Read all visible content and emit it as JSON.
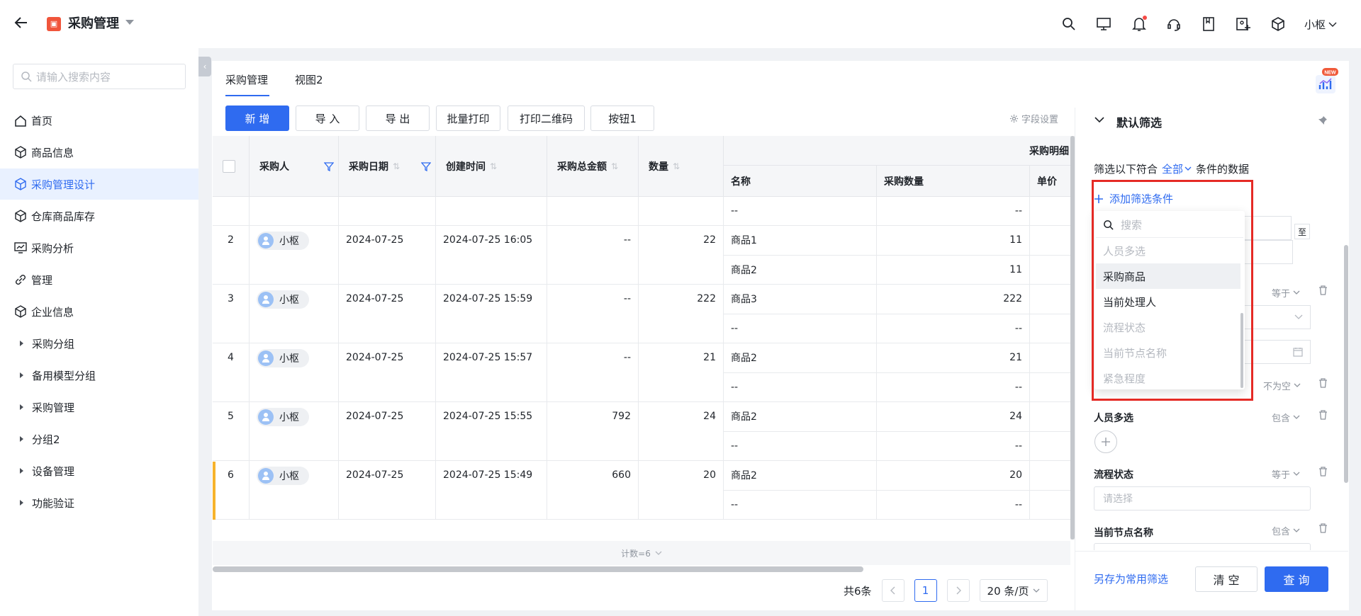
{
  "header": {
    "app_title": "采购管理",
    "user_name": "小枢"
  },
  "sidebar": {
    "search_placeholder": "请输入搜索内容",
    "items": [
      {
        "label": "首页",
        "icon": "home-icon"
      },
      {
        "label": "商品信息",
        "icon": "cube-icon"
      },
      {
        "label": "采购管理设计",
        "icon": "cube-icon",
        "active": true
      },
      {
        "label": "仓库商品库存",
        "icon": "cube-icon"
      },
      {
        "label": "采购分析",
        "icon": "monitor-chart-icon"
      },
      {
        "label": "管理",
        "icon": "link-icon"
      },
      {
        "label": "企业信息",
        "icon": "cube-icon"
      }
    ],
    "groups": [
      "采购分组",
      "备用模型分组",
      "采购管理",
      "分组2",
      "设备管理",
      "功能验证"
    ]
  },
  "tabs": [
    "采购管理",
    "视图2"
  ],
  "toolbar": {
    "buttons": [
      "新 增",
      "导 入",
      "导 出",
      "批量打印",
      "打印二维码",
      "按钮1"
    ],
    "field_settings": "字段设置"
  },
  "table": {
    "headers": {
      "buyer": "采购人",
      "date": "采购日期",
      "created": "创建时间",
      "total": "采购总金额",
      "qty": "数量",
      "detail_group": "采购明细",
      "detail_name": "名称",
      "detail_qty": "采购数量",
      "detail_unit": "单价"
    },
    "rows": [
      {
        "idx": "",
        "buyer": "",
        "date": "",
        "created": "",
        "total": "",
        "qty": "",
        "details": [
          {
            "name": "--",
            "qty": "--"
          }
        ]
      },
      {
        "idx": "2",
        "buyer": "小枢",
        "date": "2024-07-25",
        "created": "2024-07-25 16:05",
        "total": "--",
        "qty": "22",
        "details": [
          {
            "name": "商品1",
            "qty": "11"
          },
          {
            "name": "商品2",
            "qty": "11"
          }
        ]
      },
      {
        "idx": "3",
        "buyer": "小枢",
        "date": "2024-07-25",
        "created": "2024-07-25 15:59",
        "total": "--",
        "qty": "222",
        "details": [
          {
            "name": "商品3",
            "qty": "222"
          },
          {
            "name": "--",
            "qty": "--"
          }
        ]
      },
      {
        "idx": "4",
        "buyer": "小枢",
        "date": "2024-07-25",
        "created": "2024-07-25 15:57",
        "total": "--",
        "qty": "21",
        "details": [
          {
            "name": "商品2",
            "qty": "21"
          },
          {
            "name": "--",
            "qty": "--"
          }
        ]
      },
      {
        "idx": "5",
        "buyer": "小枢",
        "date": "2024-07-25",
        "created": "2024-07-25 15:55",
        "total": "792",
        "qty": "24",
        "details": [
          {
            "name": "商品2",
            "qty": "24"
          },
          {
            "name": "--",
            "qty": "--"
          }
        ]
      },
      {
        "idx": "6",
        "buyer": "小枢",
        "date": "2024-07-25",
        "created": "2024-07-25 15:49",
        "total": "660",
        "qty": "20",
        "details": [
          {
            "name": "商品2",
            "qty": "20"
          },
          {
            "name": "--",
            "qty": "--"
          }
        ]
      }
    ],
    "footer_count": "计数=6"
  },
  "pagination": {
    "total": "共6条",
    "current_page": "1",
    "page_size": "20 条/页"
  },
  "filter": {
    "title": "默认筛选",
    "match_prefix": "筛选以下符合",
    "match_mode": "全部",
    "match_suffix": "条件的数据",
    "add_condition": "添加筛选条件",
    "range_sep": "至",
    "op_equal_1": "等于",
    "op_notempty": "不为空",
    "people_label": "人员多选",
    "people_op": "包含",
    "flow_label": "流程状态",
    "flow_op": "等于",
    "flow_placeholder": "请选择",
    "node_label": "当前节点名称",
    "node_op": "包含",
    "save_common": "另存为常用筛选",
    "clear": "清 空",
    "query": "查 询",
    "dropdown": {
      "search_placeholder": "搜索",
      "options": [
        {
          "label": "人员多选",
          "disabled": true
        },
        {
          "label": "采购商品",
          "disabled": false,
          "highlight": true
        },
        {
          "label": "当前处理人",
          "disabled": false
        },
        {
          "label": "流程状态",
          "disabled": true
        },
        {
          "label": "当前节点名称",
          "disabled": true
        },
        {
          "label": "紧急程度",
          "disabled": true
        }
      ]
    }
  },
  "badge": "NEW",
  "colors": {
    "primary": "#2f6bf0",
    "highlight_border": "#e52a25",
    "row_marker": "#f6b32c",
    "notification_dot": "#f54a45"
  }
}
